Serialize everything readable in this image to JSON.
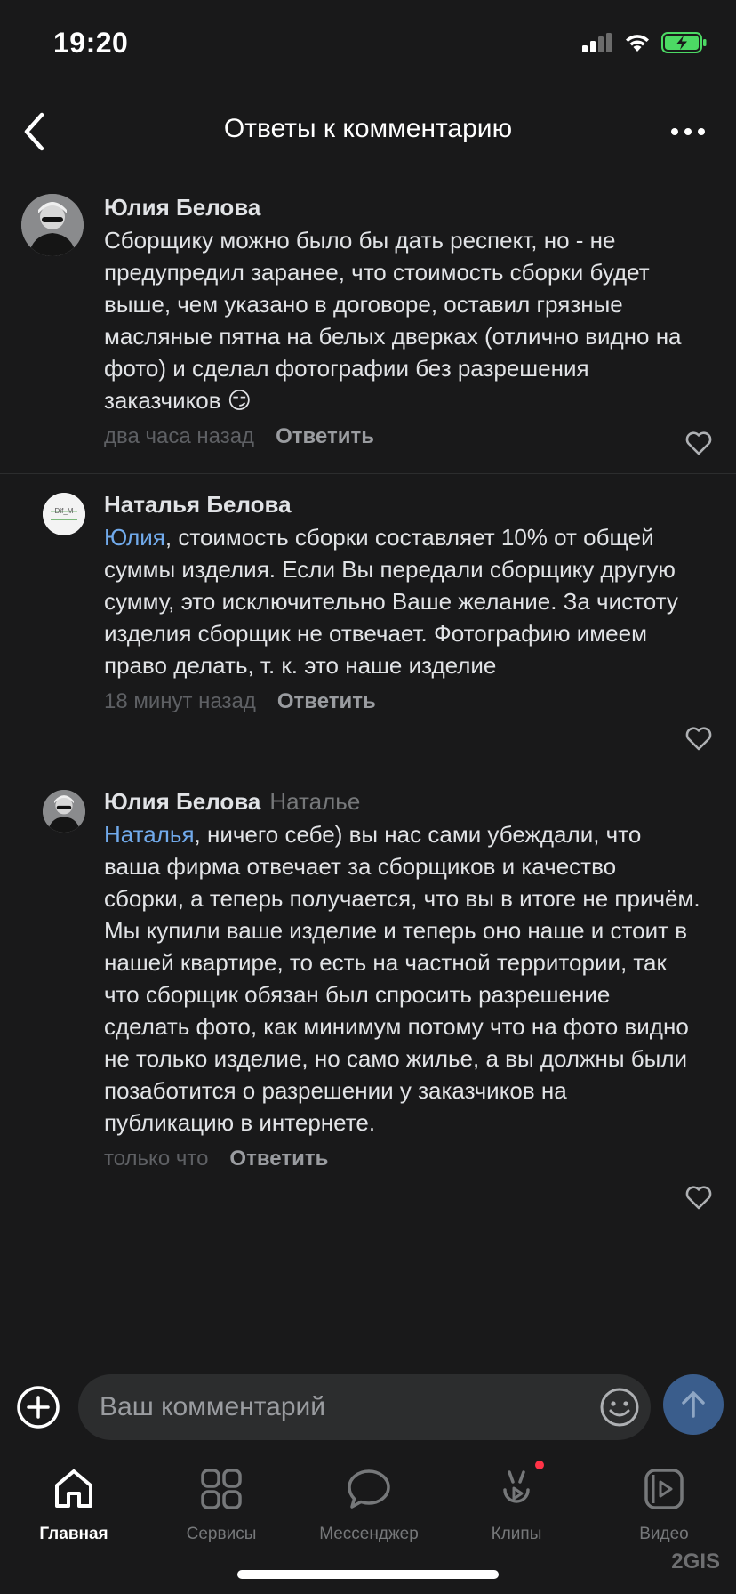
{
  "status_bar": {
    "time": "19:20"
  },
  "header": {
    "title": "Ответы к комментарию"
  },
  "comments": [
    {
      "author": "Юлия Белова",
      "reply_to": "",
      "mention": "",
      "text": "Сборщику можно было бы дать респект, но - не предупредил заранее, что стоимость сборки будет выше, чем указано в договоре, оставил грязные масляные пятна на белых дверках (отлично видно на фото) и сделал фотографии без разрешения заказчиков 😏",
      "time": "два часа назад",
      "reply_label": "Ответить"
    },
    {
      "author": "Наталья Белова",
      "reply_to": "",
      "mention": "Юлия",
      "text": ", стоимость сборки составляет 10% от общей суммы изделия. Если Вы передали сборщику другую сумму, это исключительно Ваше желание. За чистоту изделия сборщик не отвечает. Фотографию имеем право делать, т. к. это наше изделие",
      "time": "18 минут назад",
      "reply_label": "Ответить",
      "avatar_text": "Dif_M"
    },
    {
      "author": "Юлия Белова",
      "reply_to": "Наталье",
      "mention": "Наталья",
      "text": ", ничего себе) вы нас сами убеждали, что ваша фирма отвечает за сборщиков и качество сборки, а теперь получается, что вы  в итоге не причём. Мы купили ваше изделие и теперь оно наше и стоит в нашей квартире, то есть на частной территории, так что сборщик обязан был спросить разрешение сделать фото, как минимум потому что на фото видно не только изделие, но само жилье, а вы должны были позаботится о разрешении у заказчиков на публикацию в интернете.",
      "time": "только что",
      "reply_label": "Ответить"
    }
  ],
  "composer": {
    "placeholder": "Ваш комментарий"
  },
  "tabs": [
    {
      "label": "Главная",
      "icon": "home-icon",
      "active": true
    },
    {
      "label": "Сервисы",
      "icon": "services-icon",
      "active": false
    },
    {
      "label": "Мессенджер",
      "icon": "messenger-icon",
      "active": false
    },
    {
      "label": "Клипы",
      "icon": "clips-icon",
      "active": false,
      "badge": true
    },
    {
      "label": "Видео",
      "icon": "video-icon",
      "active": false
    }
  ],
  "watermark": "2GIS",
  "colors": {
    "background": "#19191a",
    "accent": "#71aaeb",
    "send_button": "#3a5d8c",
    "battery": "#4cd964",
    "badge": "#ff3347"
  }
}
